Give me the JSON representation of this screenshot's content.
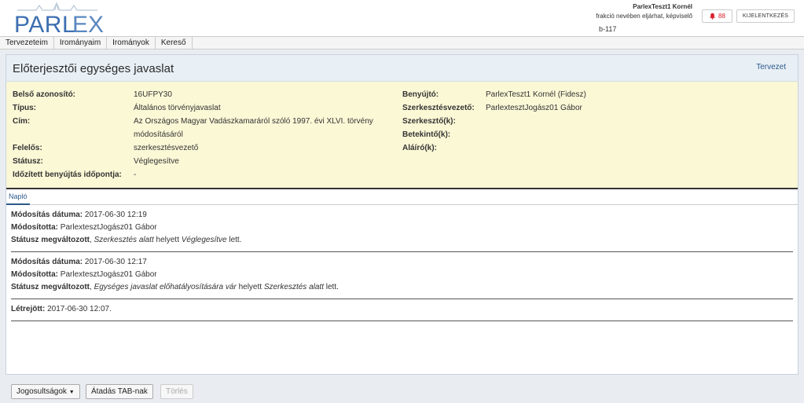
{
  "header": {
    "logo_text": "PARLEX",
    "user_name": "ParlexTeszt1 Kornél",
    "user_role": "frakció nevében eljárhat, képviselő",
    "room": "b-117",
    "notifications_count": "88",
    "logout_label": "KIJELENTKEZÉS"
  },
  "nav": {
    "items": [
      {
        "label": "Tervezeteim"
      },
      {
        "label": "Irományaim"
      },
      {
        "label": "Irományok"
      },
      {
        "label": "Kereső"
      }
    ]
  },
  "panel": {
    "title": "Előterjesztői egységes javaslat",
    "status_link": "Tervezet"
  },
  "details": {
    "left": [
      {
        "label": "Belső azonosító:",
        "value": "16UFPY30"
      },
      {
        "label": "Típus:",
        "value": "Általános törvényjavaslat"
      },
      {
        "label": "Cím:",
        "value": "Az Országos Magyar Vadászkamaráról szóló 1997. évi XLVI. törvény módosításáról"
      },
      {
        "label": "Felelős:",
        "value": "szerkesztésvezető"
      },
      {
        "label": "Státusz:",
        "value": "Véglegesítve"
      },
      {
        "label": "Időzített benyújtás időpontja:",
        "value": "-"
      }
    ],
    "right": [
      {
        "label": "Benyújtó:",
        "value": "ParlexTeszt1 Kornél (Fidesz)"
      },
      {
        "label": "Szerkesztésvezető:",
        "value": "ParlextesztJogász01 Gábor"
      },
      {
        "label": "Szerkesztő(k):",
        "value": ""
      },
      {
        "label": "Betekintő(k):",
        "value": ""
      },
      {
        "label": "Aláíró(k):",
        "value": ""
      }
    ]
  },
  "tabs": {
    "log_label": "Napló"
  },
  "log": {
    "entries": [
      {
        "date_label": "Módosítás dátuma:",
        "date": "2017-06-30 12:19",
        "by_label": "Módosította:",
        "by": "ParlextesztJogász01 Gábor",
        "change_label": "Státusz megváltozott",
        "from": "Szerkesztés alatt",
        "middle": "helyett",
        "to": "Véglegesítve",
        "end": "lett."
      },
      {
        "date_label": "Módosítás dátuma:",
        "date": "2017-06-30 12:17",
        "by_label": "Módosította:",
        "by": "ParlextesztJogász01 Gábor",
        "change_label": "Státusz megváltozott",
        "from": "Egységes javaslat előhatályosítására vár",
        "middle": "helyett",
        "to": "Szerkesztés alatt",
        "end": "lett."
      }
    ],
    "created_label": "Létrejött:",
    "created": "2017-06-30 12:07."
  },
  "footer": {
    "permissions_label": "Jogosultságok",
    "transfer_label": "Átadás TAB-nak",
    "delete_label": "Törlés"
  }
}
